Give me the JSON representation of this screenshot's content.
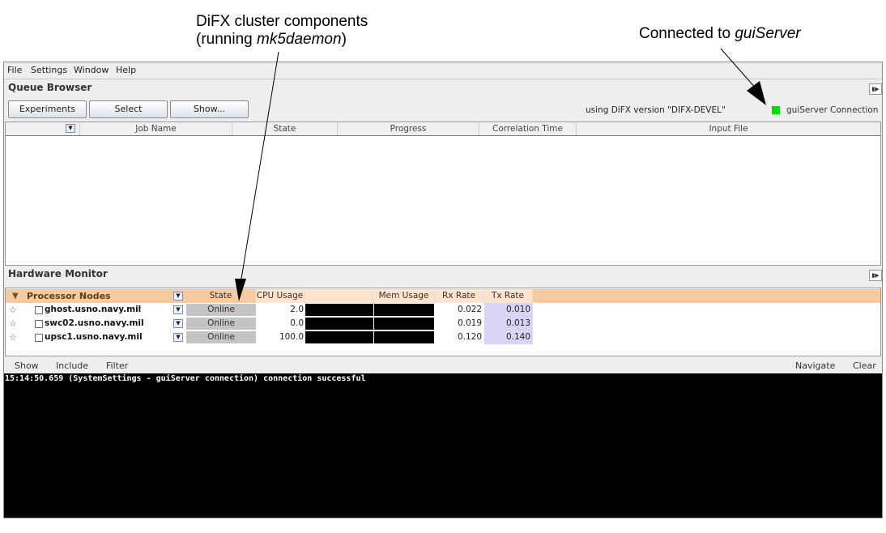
{
  "annotations": {
    "left_line1": "DiFX cluster components",
    "left_line2_prefix": "(running ",
    "left_line2_em": "mk5daemon",
    "left_line2_suffix": ")",
    "right_prefix": "Connected to ",
    "right_em": "guiServer"
  },
  "menubar": [
    "File",
    "Settings",
    "Window",
    "Help"
  ],
  "queue_browser": {
    "title": "Queue Browser",
    "buttons": [
      "Experiments",
      "Select",
      "Show..."
    ],
    "difx_version": "using DiFX version \"DIFX-DEVEL\"",
    "connection_label": "guiServer Connection",
    "connection_color": "#00e000",
    "columns": [
      "Job Name",
      "State",
      "Progress",
      "Correlation Time",
      "Input File"
    ]
  },
  "hardware_monitor": {
    "title": "Hardware Monitor",
    "group_label": "Processor Nodes",
    "header_color": "#f8caa0",
    "columns": [
      "State",
      "CPU Usage",
      "",
      "Mem Usage",
      "Rx Rate",
      "Tx Rate"
    ],
    "nodes": [
      {
        "name": "ghost.usno.navy.mil",
        "state": "Online",
        "cpu": "2.0",
        "rx": "0.022",
        "tx": "0.010"
      },
      {
        "name": "swc02.usno.navy.mil",
        "state": "Online",
        "cpu": "0.0",
        "rx": "0.019",
        "tx": "0.013"
      },
      {
        "name": "upsc1.usno.navy.mil",
        "state": "Online",
        "cpu": "100.0",
        "rx": "0.120",
        "tx": "0.140"
      }
    ]
  },
  "log": {
    "toolbar_left": [
      "Show",
      "Include",
      "Filter"
    ],
    "toolbar_right": [
      "Navigate",
      "Clear"
    ],
    "lines": [
      "15:14:50.659 (SystemSettings - guiServer connection) connection successful"
    ]
  }
}
